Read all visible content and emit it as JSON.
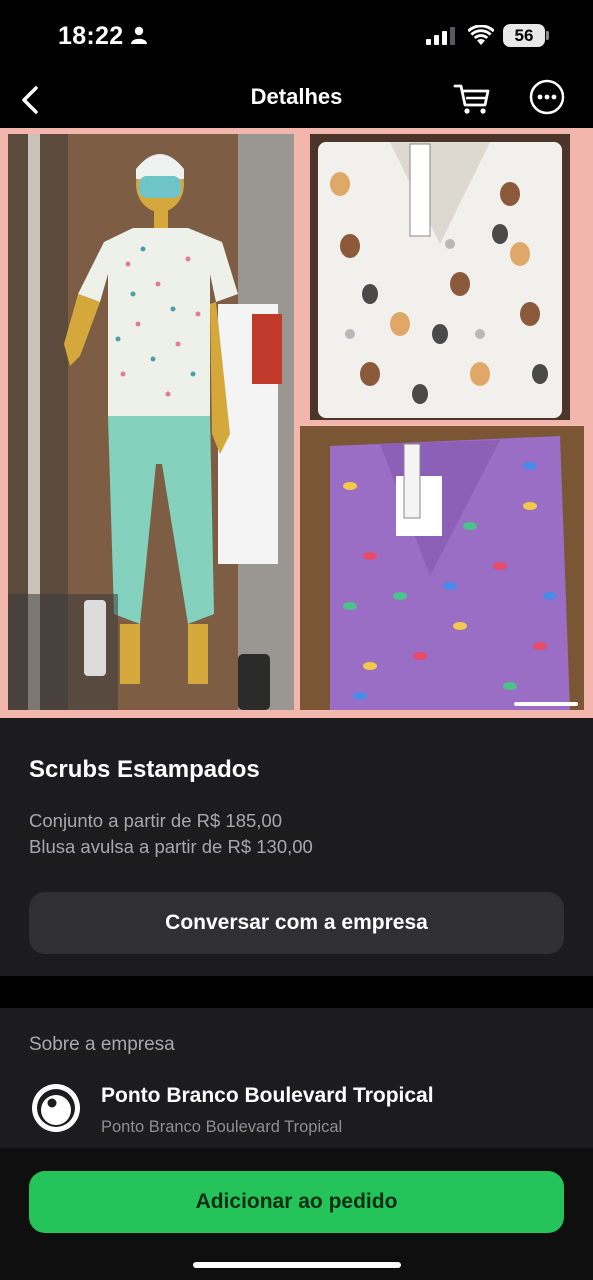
{
  "status": {
    "time": "18:22",
    "battery": "56"
  },
  "nav": {
    "title": "Detalhes"
  },
  "gallery": {
    "alt_main": "Mannequin wearing floral scrub top and mint pants",
    "alt_top": "White scrub top with dog print",
    "alt_bottom": "Purple scrub top with colorful print"
  },
  "product": {
    "title": "Scrubs Estampados",
    "desc_line1": "Conjunto a partir de R$ 185,00",
    "desc_line2": "Blusa avulsa a partir de R$ 130,00",
    "chat_label": "Conversar com a empresa"
  },
  "company": {
    "heading": "Sobre a empresa",
    "name": "Ponto Branco Boulevard Tropical",
    "subtitle": "Ponto Branco Boulevard Tropical"
  },
  "bottom": {
    "add_label": "Adicionar ao pedido"
  },
  "colors": {
    "accent": "#25c45a",
    "gallery_bg": "#f2b6ad"
  }
}
